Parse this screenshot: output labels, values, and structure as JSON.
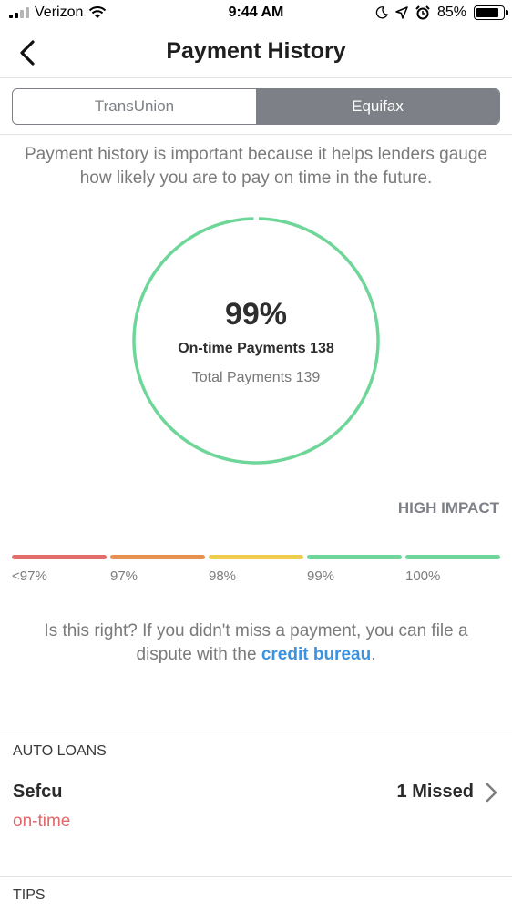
{
  "status_bar": {
    "carrier": "Verizon",
    "time": "9:44 AM",
    "battery_percent": "85%",
    "battery_level": 0.85,
    "icons": [
      "signal-icon",
      "wifi-icon",
      "moon-icon",
      "location-arrow-icon",
      "alarm-icon",
      "battery-icon"
    ]
  },
  "nav": {
    "title": "Payment History",
    "back_icon": "chevron-left-icon"
  },
  "tabs": [
    {
      "label": "TransUnion",
      "selected": false
    },
    {
      "label": "Equifax",
      "selected": true
    }
  ],
  "description": "Payment history is important because it helps lenders gauge how likely you are to pay on time in the future.",
  "summary": {
    "percent": "99%",
    "on_time": "On-time Payments 138",
    "total": "Total Payments 139",
    "ratio": 0.993,
    "ring_color": "#6fd699"
  },
  "impact": "HIGH IMPACT",
  "scale": [
    {
      "label": "<97%",
      "color": "#e46c6a"
    },
    {
      "label": "97%",
      "color": "#e8904f"
    },
    {
      "label": "98%",
      "color": "#f0cc4e"
    },
    {
      "label": "99%",
      "color": "#6fd699"
    },
    {
      "label": "100%",
      "color": "#6fd699"
    }
  ],
  "dispute": {
    "prefix": "Is this right? If you didn't miss a payment, you can file a dispute with the ",
    "link": "credit bureau",
    "suffix": "."
  },
  "sections": {
    "auto_loans": "AUTO LOANS",
    "tips": "TIPS"
  },
  "account": {
    "name": "Sefcu",
    "status": "on-time",
    "missed": "1 Missed",
    "chevron_icon": "chevron-right-icon"
  },
  "colors": {
    "accent_link": "#3b93e0",
    "segment_active": "#7d8086",
    "status_red": "#e0696b"
  }
}
